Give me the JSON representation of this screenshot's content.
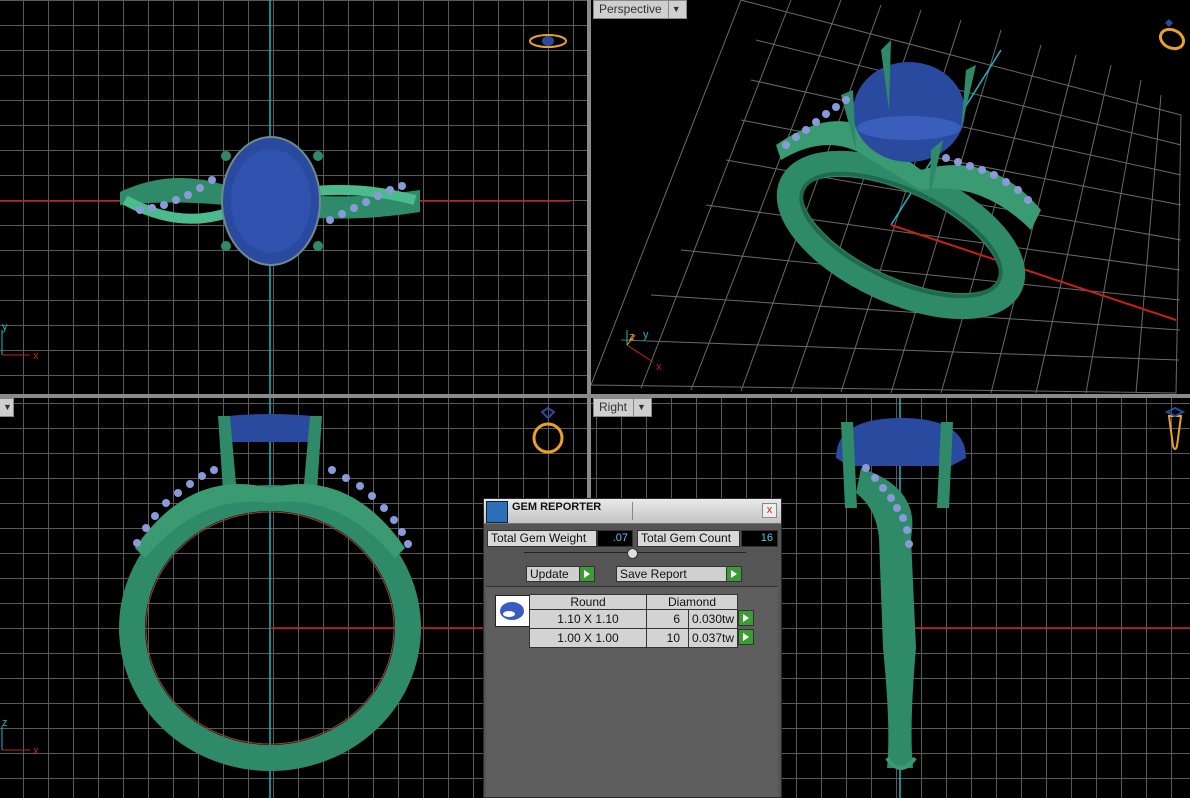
{
  "viewports": {
    "perspective": {
      "label": "Perspective"
    },
    "right": {
      "label": "Right"
    }
  },
  "axes": {
    "x": "x",
    "y": "y",
    "z": "z"
  },
  "gem_reporter": {
    "title": "GEM REPORTER",
    "total_weight_label": "Total Gem Weight",
    "total_weight_value": ".07",
    "total_count_label": "Total Gem Count",
    "total_count_value": "16",
    "update_label": "Update",
    "save_report_label": "Save Report",
    "close_glyph": "x",
    "table": {
      "shape_header": "Round",
      "material_header": "Diamond",
      "rows": [
        {
          "size": "1.10 X 1.10",
          "count": "6",
          "weight": "0.030tw"
        },
        {
          "size": "1.00 X 1.00",
          "count": "10",
          "weight": "0.037tw"
        }
      ]
    }
  },
  "colors": {
    "metal": "#2e8a68",
    "gem": "#2a4aa0",
    "accent_small_gem": "#8a9ad8",
    "ui_value": "#57c7f4",
    "go_button": "#3c9b34"
  },
  "icons": [
    "ring-top-icon",
    "ring-persp-icon",
    "ring-front-icon",
    "ring-side-icon",
    "gem-list-icon",
    "close-icon",
    "play-icon"
  ]
}
